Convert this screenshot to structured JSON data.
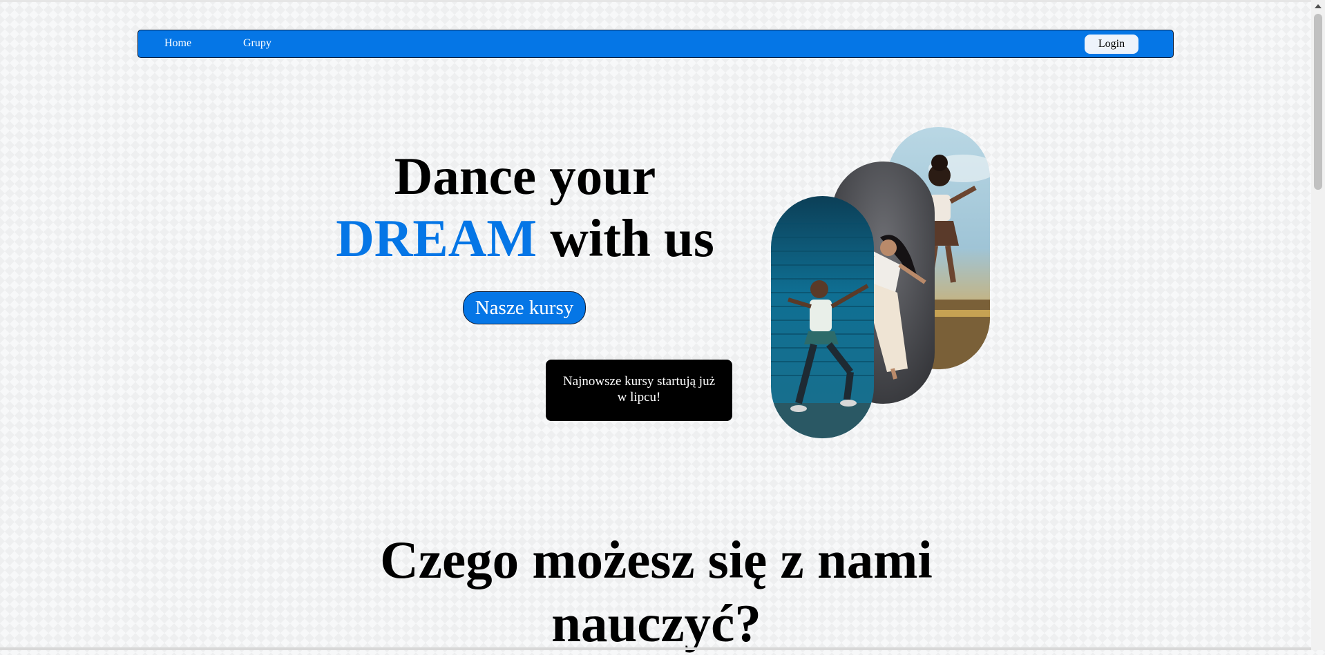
{
  "nav": {
    "home_label": "Home",
    "groups_label": "Grupy",
    "login_label": "Login",
    "bar_color": "#0576e6"
  },
  "hero": {
    "title_part1": "Dance your",
    "title_accent": "DREAM",
    "title_part2": "with us",
    "accent_color": "#0576e6",
    "cta_label": "Nasze kursy",
    "notice": "Najnowsze kursy startują już w lipcu!"
  },
  "gallery": {
    "images": [
      {
        "icon": "dancer-photo",
        "scene": "man dancing in front of blue shutter"
      },
      {
        "icon": "dancer-photo",
        "scene": "woman dancing against dark grey backdrop"
      },
      {
        "icon": "dancer-photo",
        "scene": "woman jumping under cloudy sky"
      }
    ]
  },
  "section": {
    "title": "Czego możesz się z nami nauczyć?"
  }
}
